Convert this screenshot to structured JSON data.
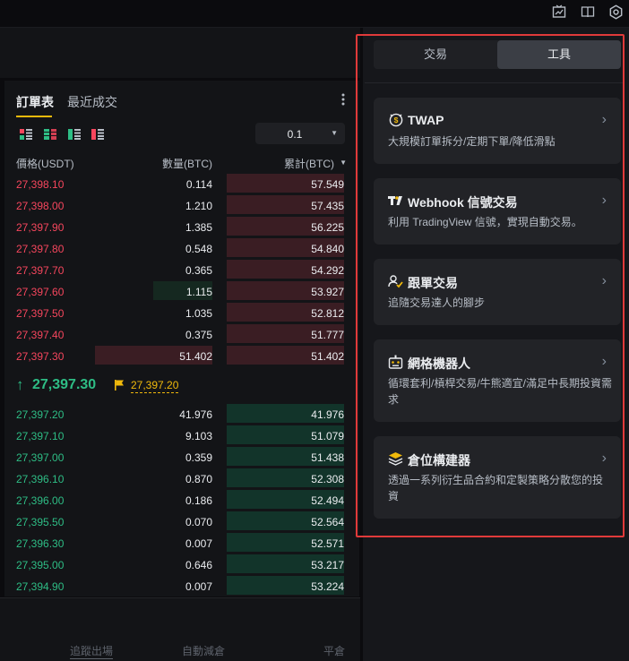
{
  "topbar": {
    "icons": [
      "chart-screen-icon",
      "book-icon",
      "settings-icon"
    ]
  },
  "orderbook": {
    "tabs": [
      "訂單表",
      "最近成交"
    ],
    "precision": "0.1",
    "headers": {
      "price": "價格(USDT)",
      "qty": "數量(BTC)",
      "total": "累計(BTC)"
    },
    "asks": [
      {
        "price": "27,398.10",
        "qty": "0.114",
        "total": "57.549",
        "depth": 1.0,
        "qdepth": 0
      },
      {
        "price": "27,398.00",
        "qty": "1.210",
        "total": "57.435",
        "depth": 1.0,
        "qdepth": 0
      },
      {
        "price": "27,397.90",
        "qty": "1.385",
        "total": "56.225",
        "depth": 1.0,
        "qdepth": 0
      },
      {
        "price": "27,397.80",
        "qty": "0.548",
        "total": "54.840",
        "depth": 1.0,
        "qdepth": 0
      },
      {
        "price": "27,397.70",
        "qty": "0.365",
        "total": "54.292",
        "depth": 1.0,
        "qdepth": 0
      },
      {
        "price": "27,397.60",
        "qty": "1.115",
        "total": "53.927",
        "depth": 1.0,
        "qdepth": 0.5
      },
      {
        "price": "27,397.50",
        "qty": "1.035",
        "total": "52.812",
        "depth": 1.0,
        "qdepth": 0
      },
      {
        "price": "27,397.40",
        "qty": "0.375",
        "total": "51.777",
        "depth": 1.0,
        "qdepth": 0
      },
      {
        "price": "27,397.30",
        "qty": "51.402",
        "total": "51.402",
        "depth": 1.0,
        "qdepth": 1.0
      }
    ],
    "last_price": "27,397.30",
    "mark_price": "27,397.20",
    "bids": [
      {
        "price": "27,397.20",
        "qty": "41.976",
        "total": "41.976",
        "depth": 1.0
      },
      {
        "price": "27,397.10",
        "qty": "9.103",
        "total": "51.079",
        "depth": 1.0
      },
      {
        "price": "27,397.00",
        "qty": "0.359",
        "total": "51.438",
        "depth": 1.0
      },
      {
        "price": "27,396.10",
        "qty": "0.870",
        "total": "52.308",
        "depth": 1.0
      },
      {
        "price": "27,396.00",
        "qty": "0.186",
        "total": "52.494",
        "depth": 1.0
      },
      {
        "price": "27,395.50",
        "qty": "0.070",
        "total": "52.564",
        "depth": 1.0
      },
      {
        "price": "27,396.30",
        "qty": "0.007",
        "total": "52.571",
        "depth": 1.0
      },
      {
        "price": "27,395.00",
        "qty": "0.646",
        "total": "53.217",
        "depth": 1.0
      },
      {
        "price": "27,394.90",
        "qty": "0.007",
        "total": "53.224",
        "depth": 1.0
      }
    ]
  },
  "bottom": {
    "labels": [
      "追蹤出場",
      "自動減倉",
      "平倉"
    ]
  },
  "tools_panel": {
    "segments": [
      "交易",
      "工具"
    ],
    "cards": [
      {
        "title": "TWAP",
        "desc": "大規模訂單拆分/定期下單/降低滑點",
        "icon": "twap-icon"
      },
      {
        "title": "Webhook 信號交易",
        "desc": "利用 TradingView 信號，實現自動交易。",
        "icon": "tradingview-icon"
      },
      {
        "title": "跟單交易",
        "desc": "追隨交易達人的腳步",
        "icon": "copy-trade-icon"
      },
      {
        "title": "網格機器人",
        "desc": "循環套利/槓桿交易/牛熊適宜/滿足中長期投資需求",
        "icon": "grid-bot-icon"
      },
      {
        "title": "倉位構建器",
        "desc": "透過一系列衍生品合約和定製策略分散您的投資",
        "icon": "position-builder-icon"
      }
    ]
  },
  "colors": {
    "ask": "#f6465d",
    "bid": "#2ebd85",
    "accent": "#f0b90b",
    "highlight": "#e03a3a"
  }
}
